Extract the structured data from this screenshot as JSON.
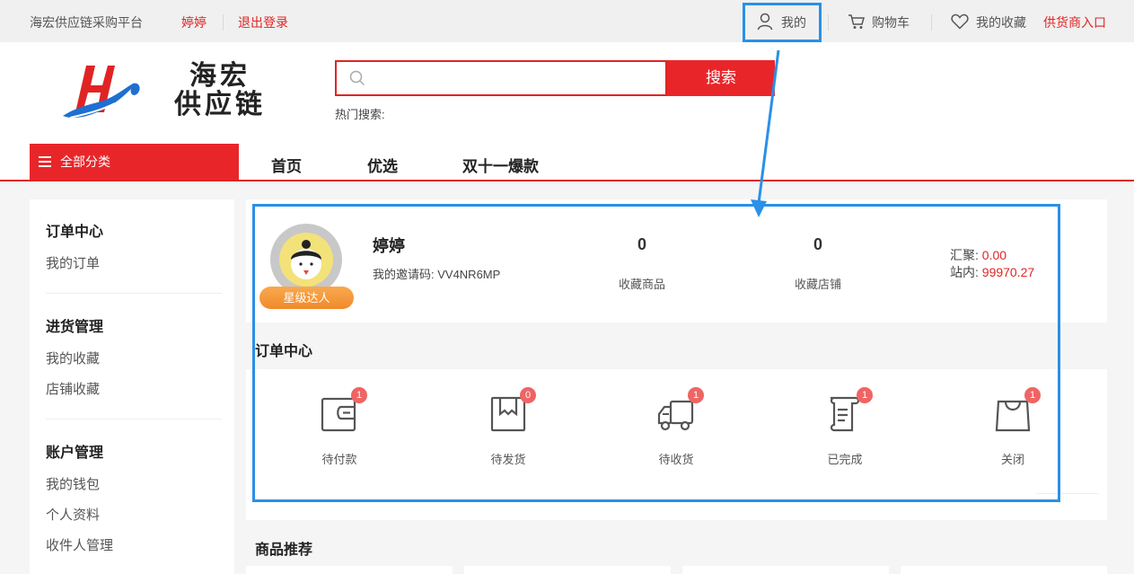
{
  "topbar": {
    "platform": "海宏供应链采购平台",
    "username": "婷婷",
    "logout": "退出登录",
    "mine": "我的",
    "cart": "购物车",
    "favorites": "我的收藏",
    "supplier_entry": "供货商入口"
  },
  "header": {
    "logo_line1": "海宏",
    "logo_line2": "供应链",
    "search_placeholder": "",
    "search_button": "搜索",
    "hot_search": "热门搜索:"
  },
  "nav": {
    "all_categories": "全部分类",
    "items": [
      "首页",
      "优选",
      "双十一爆款"
    ]
  },
  "sidebar": {
    "groups": [
      {
        "title": "订单中心",
        "items": [
          "我的订单"
        ]
      },
      {
        "title": "进货管理",
        "items": [
          "我的收藏",
          "店铺收藏"
        ]
      },
      {
        "title": "账户管理",
        "items": [
          "我的钱包",
          "个人资料",
          "收件人管理"
        ]
      }
    ]
  },
  "profile": {
    "name": "婷婷",
    "invite": "我的邀请码: VV4NR6MP",
    "level": "星级达人",
    "fav_goods_count": "0",
    "fav_goods_label": "收藏商品",
    "fav_shops_count": "0",
    "fav_shops_label": "收藏店铺",
    "huiju_label": "汇聚: ",
    "huiju_value": "0.00",
    "station_label": "站内: ",
    "station_value": "99970.27"
  },
  "orders": {
    "title": "订单中心",
    "items": [
      {
        "label": "待付款",
        "count": "1",
        "icon": "wallet-icon"
      },
      {
        "label": "待发货",
        "count": "0",
        "icon": "box-icon"
      },
      {
        "label": "待收货",
        "count": "1",
        "icon": "truck-icon"
      },
      {
        "label": "已完成",
        "count": "1",
        "icon": "document-icon"
      },
      {
        "label": "关闭",
        "count": "1",
        "icon": "bag-icon"
      }
    ]
  },
  "recommend": {
    "title": "商品推荐"
  },
  "colors": {
    "brand_red": "#e8262a",
    "highlight_blue": "#2a90e8",
    "level_orange": "#f08a2b"
  }
}
